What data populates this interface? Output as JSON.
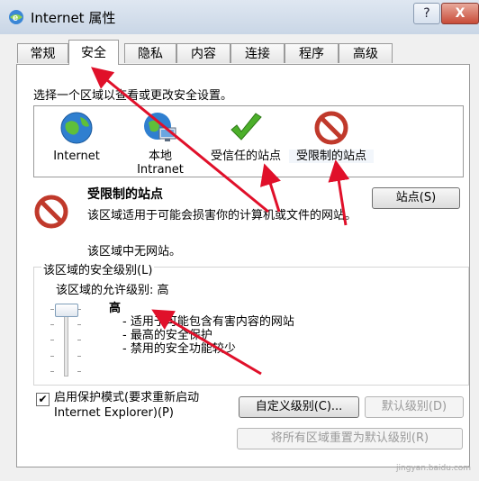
{
  "window": {
    "title": "Internet 属性",
    "help_label": "?",
    "close_label": "X"
  },
  "tabs": [
    {
      "label": "常规"
    },
    {
      "label": "安全"
    },
    {
      "label": "隐私"
    },
    {
      "label": "内容"
    },
    {
      "label": "连接"
    },
    {
      "label": "程序"
    },
    {
      "label": "高级"
    }
  ],
  "active_tab": "安全",
  "zones_prompt": "选择一个区域以查看或更改安全设置。",
  "zones": [
    {
      "line1": "Internet",
      "line2": "",
      "icon": "globe-icon"
    },
    {
      "line1": "本地",
      "line2": "Intranet",
      "icon": "local-intranet-icon"
    },
    {
      "line1": "受信任的站点",
      "line2": "",
      "icon": "checkmark-icon"
    },
    {
      "line1": "受限制的站点",
      "line2": "",
      "icon": "restricted-icon"
    }
  ],
  "selected_zone": "受限制的站点",
  "description": {
    "title": "受限制的站点",
    "text1": "该区域适用于可能会损害你的计算机或文件的网站。",
    "text2": "该区域中无网站。"
  },
  "sites_button": "站点(S)",
  "security_level": {
    "group_title": "该区域的安全级别(L)",
    "allowed": "该区域的允许级别: 高",
    "level_name": "高",
    "bullets": [
      "- 适用于可能包含有害内容的网站",
      "- 最高的安全保护",
      "- 禁用的安全功能较少"
    ]
  },
  "protected_mode": {
    "checked": true,
    "line1": "启用保护模式(要求重新启动",
    "line2": "Internet Explorer)(P)"
  },
  "buttons": {
    "custom": "自定义级别(C)...",
    "default": "默认级别(D)",
    "reset_all": "将所有区域重置为默认级别(R)"
  },
  "watermark": "jingyan.baidu.com",
  "colors": {
    "arrow": "#e0102a",
    "title_bar": "#c9d6e6",
    "close_button": "#c84b38"
  }
}
